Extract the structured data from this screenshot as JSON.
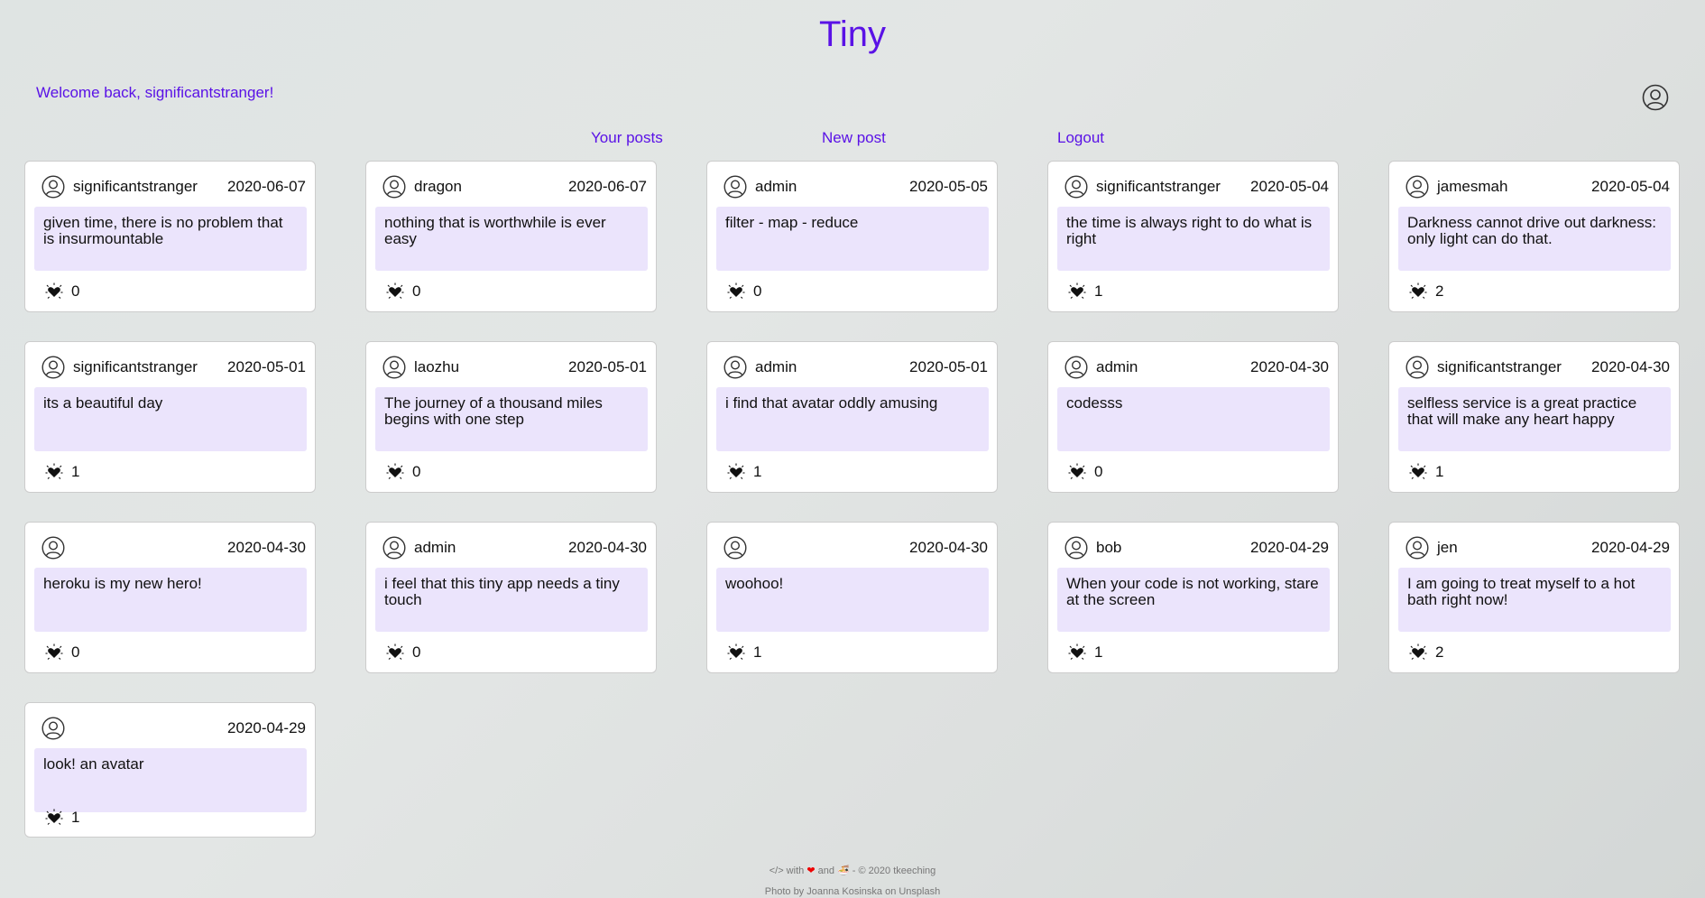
{
  "app": {
    "title": "Tiny"
  },
  "header": {
    "welcome": "Welcome back, significantstranger!"
  },
  "nav": {
    "your_posts": "Your posts",
    "new_post": "New post",
    "logout": "Logout"
  },
  "posts": [
    {
      "user": "significantstranger",
      "date": "2020-06-07",
      "content": "given time, there is no problem that is insurmountable",
      "likes": "0"
    },
    {
      "user": "dragon",
      "date": "2020-06-07",
      "content": "nothing that is worthwhile is ever easy",
      "likes": "0"
    },
    {
      "user": "admin",
      "date": "2020-05-05",
      "content": "filter - map - reduce",
      "likes": "0"
    },
    {
      "user": "significantstranger",
      "date": "2020-05-04",
      "content": "the time is always right to do what is right",
      "likes": "1"
    },
    {
      "user": "jamesmah",
      "date": "2020-05-04",
      "content": "Darkness cannot drive out darkness: only light can do that.",
      "likes": "2"
    },
    {
      "user": "significantstranger",
      "date": "2020-05-01",
      "content": "its a beautiful day",
      "likes": "1"
    },
    {
      "user": "laozhu",
      "date": "2020-05-01",
      "content": "The journey of a thousand miles begins with one step",
      "likes": "0"
    },
    {
      "user": "admin",
      "date": "2020-05-01",
      "content": "i find that avatar oddly amusing",
      "likes": "1"
    },
    {
      "user": "admin",
      "date": "2020-04-30",
      "content": "codesss",
      "likes": "0"
    },
    {
      "user": "significantstranger",
      "date": "2020-04-30",
      "content": "selfless service is a great practice that will make any heart happy",
      "likes": "1"
    },
    {
      "user": "",
      "date": "2020-04-30",
      "content": "heroku is my new hero!",
      "likes": "0"
    },
    {
      "user": "admin",
      "date": "2020-04-30",
      "content": "i feel that this tiny app needs a tiny touch",
      "likes": "0"
    },
    {
      "user": "",
      "date": "2020-04-30",
      "content": "woohoo!",
      "likes": "1"
    },
    {
      "user": "bob",
      "date": "2020-04-29",
      "content": "When your code is not working, stare at the screen",
      "likes": "1"
    },
    {
      "user": "jen",
      "date": "2020-04-29",
      "content": "I am going to treat myself to a hot bath right now!",
      "likes": "2"
    },
    {
      "user": "",
      "date": "2020-04-29",
      "content": "look! an avatar",
      "likes": "1"
    }
  ],
  "footer": {
    "code_mark": "</> with",
    "heart": "❤",
    "and": "and",
    "food": "🍜",
    "copyright": "- © 2020 tkeeching",
    "photo_credit": "Photo by Joanna Kosinska on Unsplash"
  },
  "colors": {
    "accent": "#5a12e6",
    "content_bg": "#ebe4fc",
    "card_bg": "#ffffff"
  },
  "icons": {
    "user": "user-circle-icon",
    "like": "sparkle-heart-icon"
  }
}
